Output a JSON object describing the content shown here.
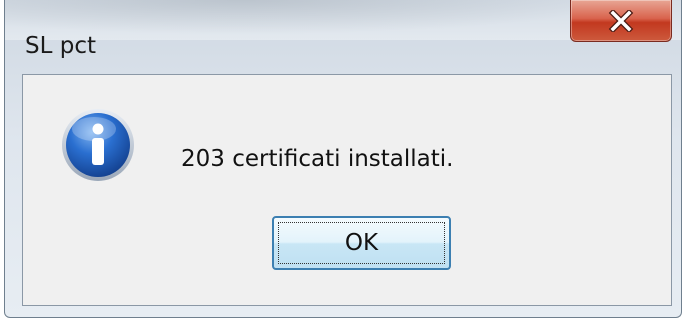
{
  "window": {
    "title": "SL pct"
  },
  "titlebar": {
    "close_icon": "close-icon"
  },
  "dialog": {
    "icon": "info-icon",
    "message": "203 certificati installati.",
    "ok_label": "OK"
  },
  "colors": {
    "close_button": "#c94a33",
    "info_icon": "#1f5fb8",
    "ok_border": "#3c7fb1"
  }
}
